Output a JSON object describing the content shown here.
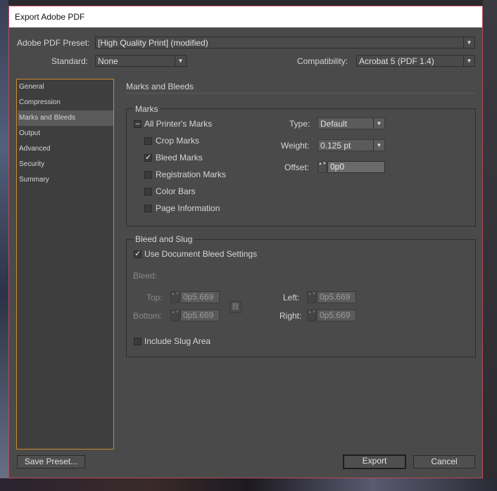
{
  "window": {
    "title": "Export Adobe PDF"
  },
  "preset": {
    "label": "Adobe PDF Preset:",
    "value": "[High Quality Print] (modified)"
  },
  "standard": {
    "label": "Standard:",
    "value": "None"
  },
  "compatibility": {
    "label": "Compatibility:",
    "value": "Acrobat 5 (PDF 1.4)"
  },
  "sidebar": {
    "items": [
      {
        "label": "General"
      },
      {
        "label": "Compression"
      },
      {
        "label": "Marks and Bleeds",
        "active": true
      },
      {
        "label": "Output"
      },
      {
        "label": "Advanced"
      },
      {
        "label": "Security"
      },
      {
        "label": "Summary"
      }
    ]
  },
  "panel": {
    "heading": "Marks and Bleeds"
  },
  "marks": {
    "group_label": "Marks",
    "all_printers_marks": {
      "label": "All Printer's Marks",
      "state": "mixed"
    },
    "crop_marks": {
      "label": "Crop Marks",
      "checked": false
    },
    "bleed_marks": {
      "label": "Bleed Marks",
      "checked": true
    },
    "registration_marks": {
      "label": "Registration Marks",
      "checked": false
    },
    "color_bars": {
      "label": "Color Bars",
      "checked": false
    },
    "page_information": {
      "label": "Page Information",
      "checked": false
    },
    "type": {
      "label": "Type:",
      "value": "Default"
    },
    "weight": {
      "label": "Weight:",
      "value": "0.125 pt"
    },
    "offset": {
      "label": "Offset:",
      "value": "0p0"
    }
  },
  "bleed_slug": {
    "group_label": "Bleed and Slug",
    "use_doc_bleed": {
      "label": "Use Document Bleed Settings",
      "checked": true
    },
    "bleed_label": "Bleed:",
    "top": {
      "label": "Top:",
      "value": "0p5.669"
    },
    "bottom": {
      "label": "Bottom:",
      "value": "0p5.669"
    },
    "left": {
      "label": "Left:",
      "value": "0p5.669"
    },
    "right": {
      "label": "Right:",
      "value": "0p5.669"
    },
    "include_slug": {
      "label": "Include Slug Area",
      "checked": false
    }
  },
  "buttons": {
    "save_preset": "Save Preset...",
    "export": "Export",
    "cancel": "Cancel"
  },
  "icons": {
    "dropdown": "▼",
    "spin": "▲▼",
    "check": "✓",
    "mixed": "–",
    "link": "⛓"
  },
  "colors": {
    "dialog_border": "#b74a55",
    "sidebar_border": "#d08a2c"
  }
}
